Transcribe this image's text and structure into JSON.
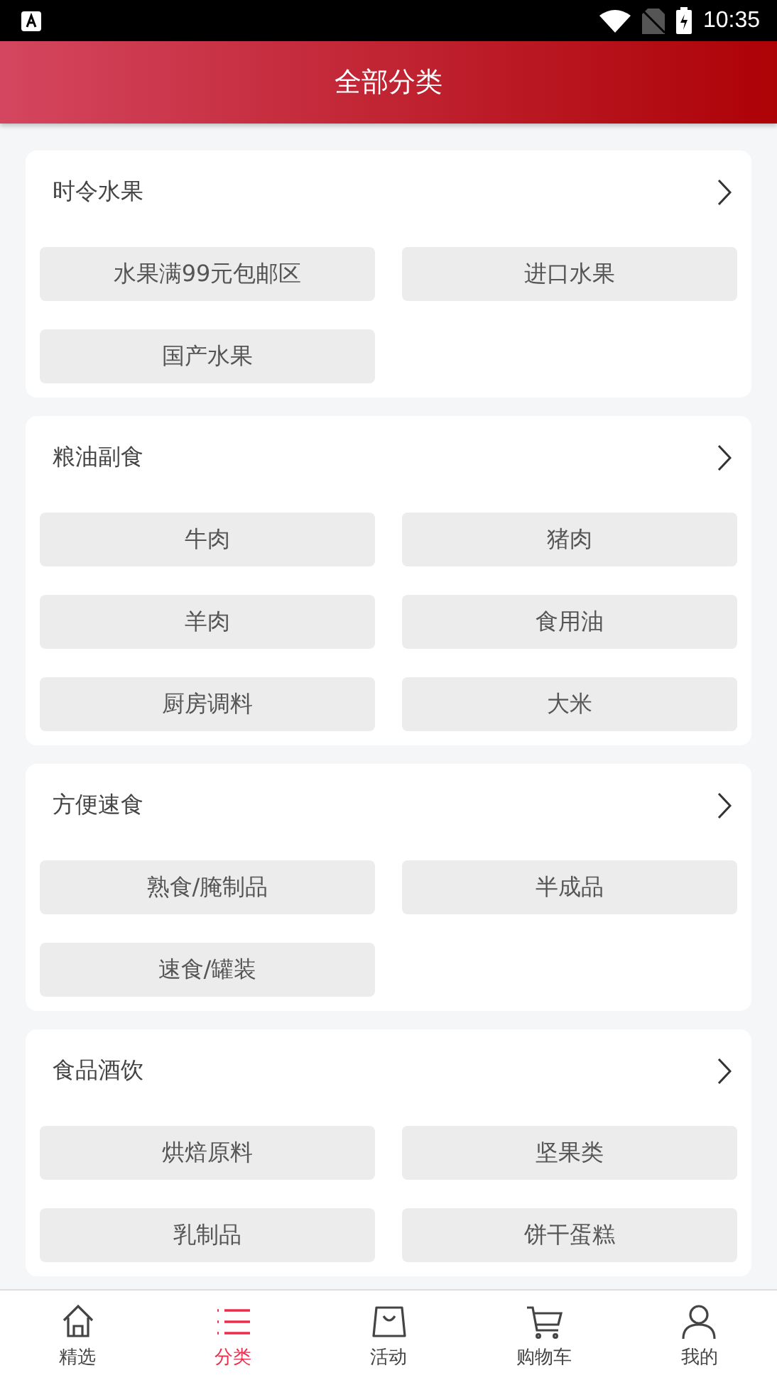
{
  "status_bar": {
    "time": "10:35"
  },
  "header": {
    "title": "全部分类"
  },
  "categories": [
    {
      "title": "时令水果",
      "items": [
        "水果满99元包邮区",
        "进口水果",
        "国产水果"
      ]
    },
    {
      "title": "粮油副食",
      "items": [
        "牛肉",
        "猪肉",
        "羊肉",
        "食用油",
        "厨房调料",
        "大米"
      ]
    },
    {
      "title": "方便速食",
      "items": [
        "熟食/腌制品",
        "半成品",
        "速食/罐装"
      ]
    },
    {
      "title": "食品酒饮",
      "items": [
        "烘焙原料",
        "坚果类",
        "乳制品",
        "饼干蛋糕"
      ]
    }
  ],
  "tab_bar": [
    {
      "label": "精选",
      "kind": "home",
      "selected": false
    },
    {
      "label": "分类",
      "kind": "list",
      "selected": true
    },
    {
      "label": "活动",
      "kind": "bag",
      "selected": false
    },
    {
      "label": "购物车",
      "kind": "cart",
      "selected": false
    },
    {
      "label": "我的",
      "kind": "person",
      "selected": false
    }
  ]
}
